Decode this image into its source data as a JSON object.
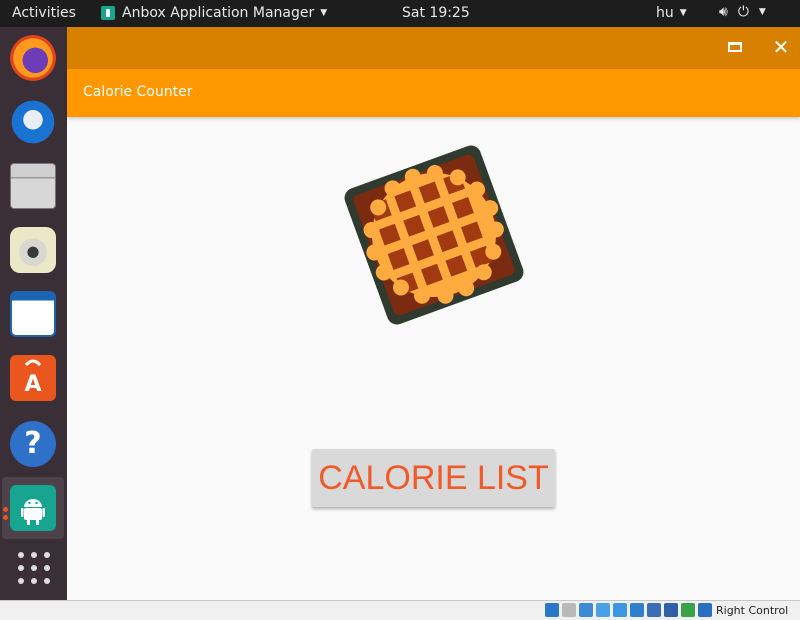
{
  "topbar": {
    "activities": "Activities",
    "app_name": "Anbox Application Manager",
    "clock": "Sat 19:25",
    "language": "hu"
  },
  "dock": {
    "items": [
      {
        "name": "firefox-icon"
      },
      {
        "name": "thunderbird-icon"
      },
      {
        "name": "files-icon"
      },
      {
        "name": "rhythmbox-icon"
      },
      {
        "name": "libreoffice-writer-icon"
      },
      {
        "name": "ubuntu-software-icon"
      },
      {
        "name": "help-icon",
        "glyph": "?"
      },
      {
        "name": "anbox-icon"
      },
      {
        "name": "show-applications-icon"
      }
    ]
  },
  "window": {
    "appbar_title": "Calorie Counter",
    "accent_color": "#ff9800",
    "titlebar_color": "#d88100",
    "button_label": "CALORIE LIST",
    "button_text_color": "#f05a28"
  },
  "statusbar": {
    "right_control": "Right Control"
  }
}
